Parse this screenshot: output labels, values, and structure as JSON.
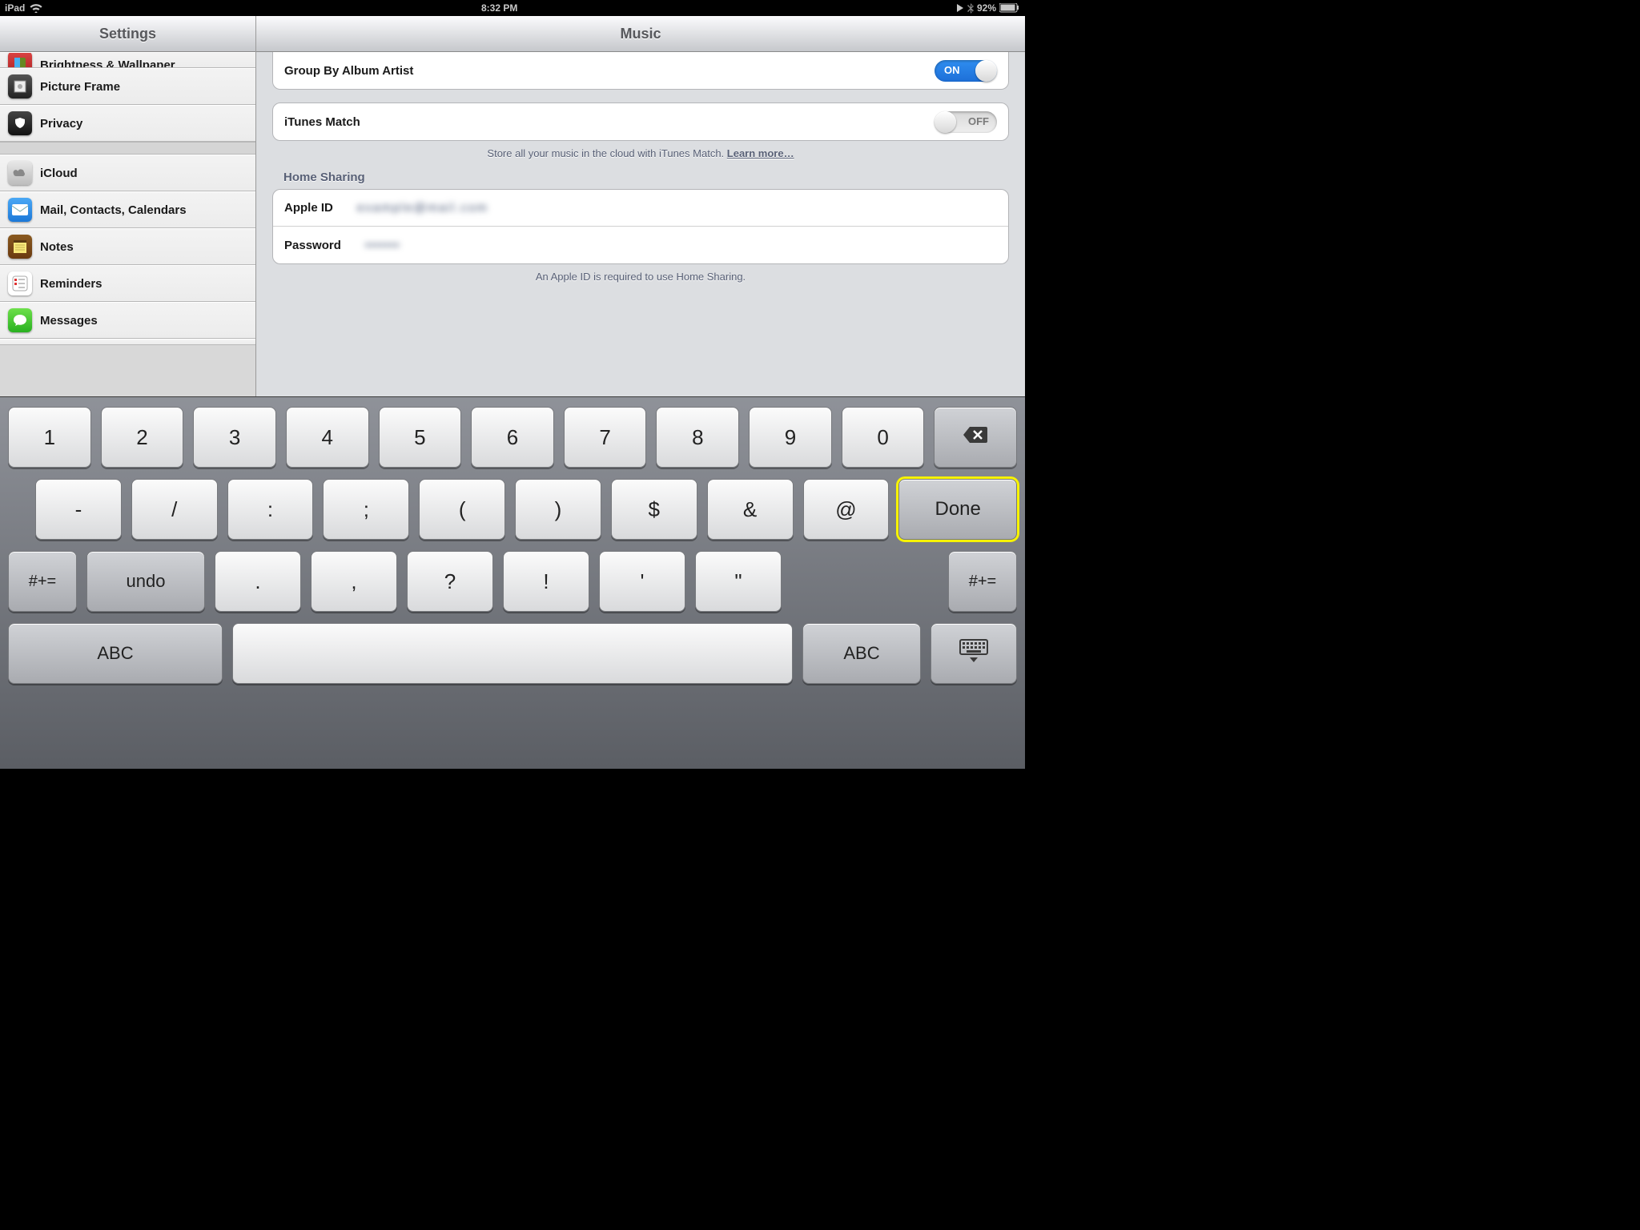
{
  "statusbar": {
    "device": "iPad",
    "time": "8:32 PM",
    "battery_pct": "92%"
  },
  "sidebar": {
    "title": "Settings",
    "items": [
      {
        "id": "brightness",
        "label": "Brightness & Wallpaper"
      },
      {
        "id": "pictureframe",
        "label": "Picture Frame"
      },
      {
        "id": "privacy",
        "label": "Privacy"
      },
      {
        "id": "icloud",
        "label": "iCloud"
      },
      {
        "id": "mail",
        "label": "Mail, Contacts, Calendars"
      },
      {
        "id": "notes",
        "label": "Notes"
      },
      {
        "id": "reminders",
        "label": "Reminders"
      },
      {
        "id": "messages",
        "label": "Messages"
      }
    ]
  },
  "detail": {
    "title": "Music",
    "group_by_label": "Group By Album Artist",
    "group_by_on": "ON",
    "itunes_match_label": "iTunes Match",
    "itunes_match_off": "OFF",
    "itunes_match_footer": "Store all your music in the cloud with iTunes Match. ",
    "learn_more": "Learn more…",
    "home_sharing_title": "Home Sharing",
    "apple_id_label": "Apple ID",
    "apple_id_value": "example@mail.com",
    "password_label": "Password",
    "password_value": "•••••••",
    "home_sharing_footer": "An Apple ID is required to use Home Sharing."
  },
  "keyboard": {
    "row1": [
      "1",
      "2",
      "3",
      "4",
      "5",
      "6",
      "7",
      "8",
      "9",
      "0"
    ],
    "row2": [
      "-",
      "/",
      ":",
      ";",
      "(",
      ")",
      "$",
      "&",
      "@"
    ],
    "done": "Done",
    "row3_shift": "#+=",
    "undo": "undo",
    "row3": [
      ".",
      ",",
      "?",
      "!",
      "'",
      "\""
    ],
    "abc": "ABC",
    "row3_shift_r": "#+="
  }
}
